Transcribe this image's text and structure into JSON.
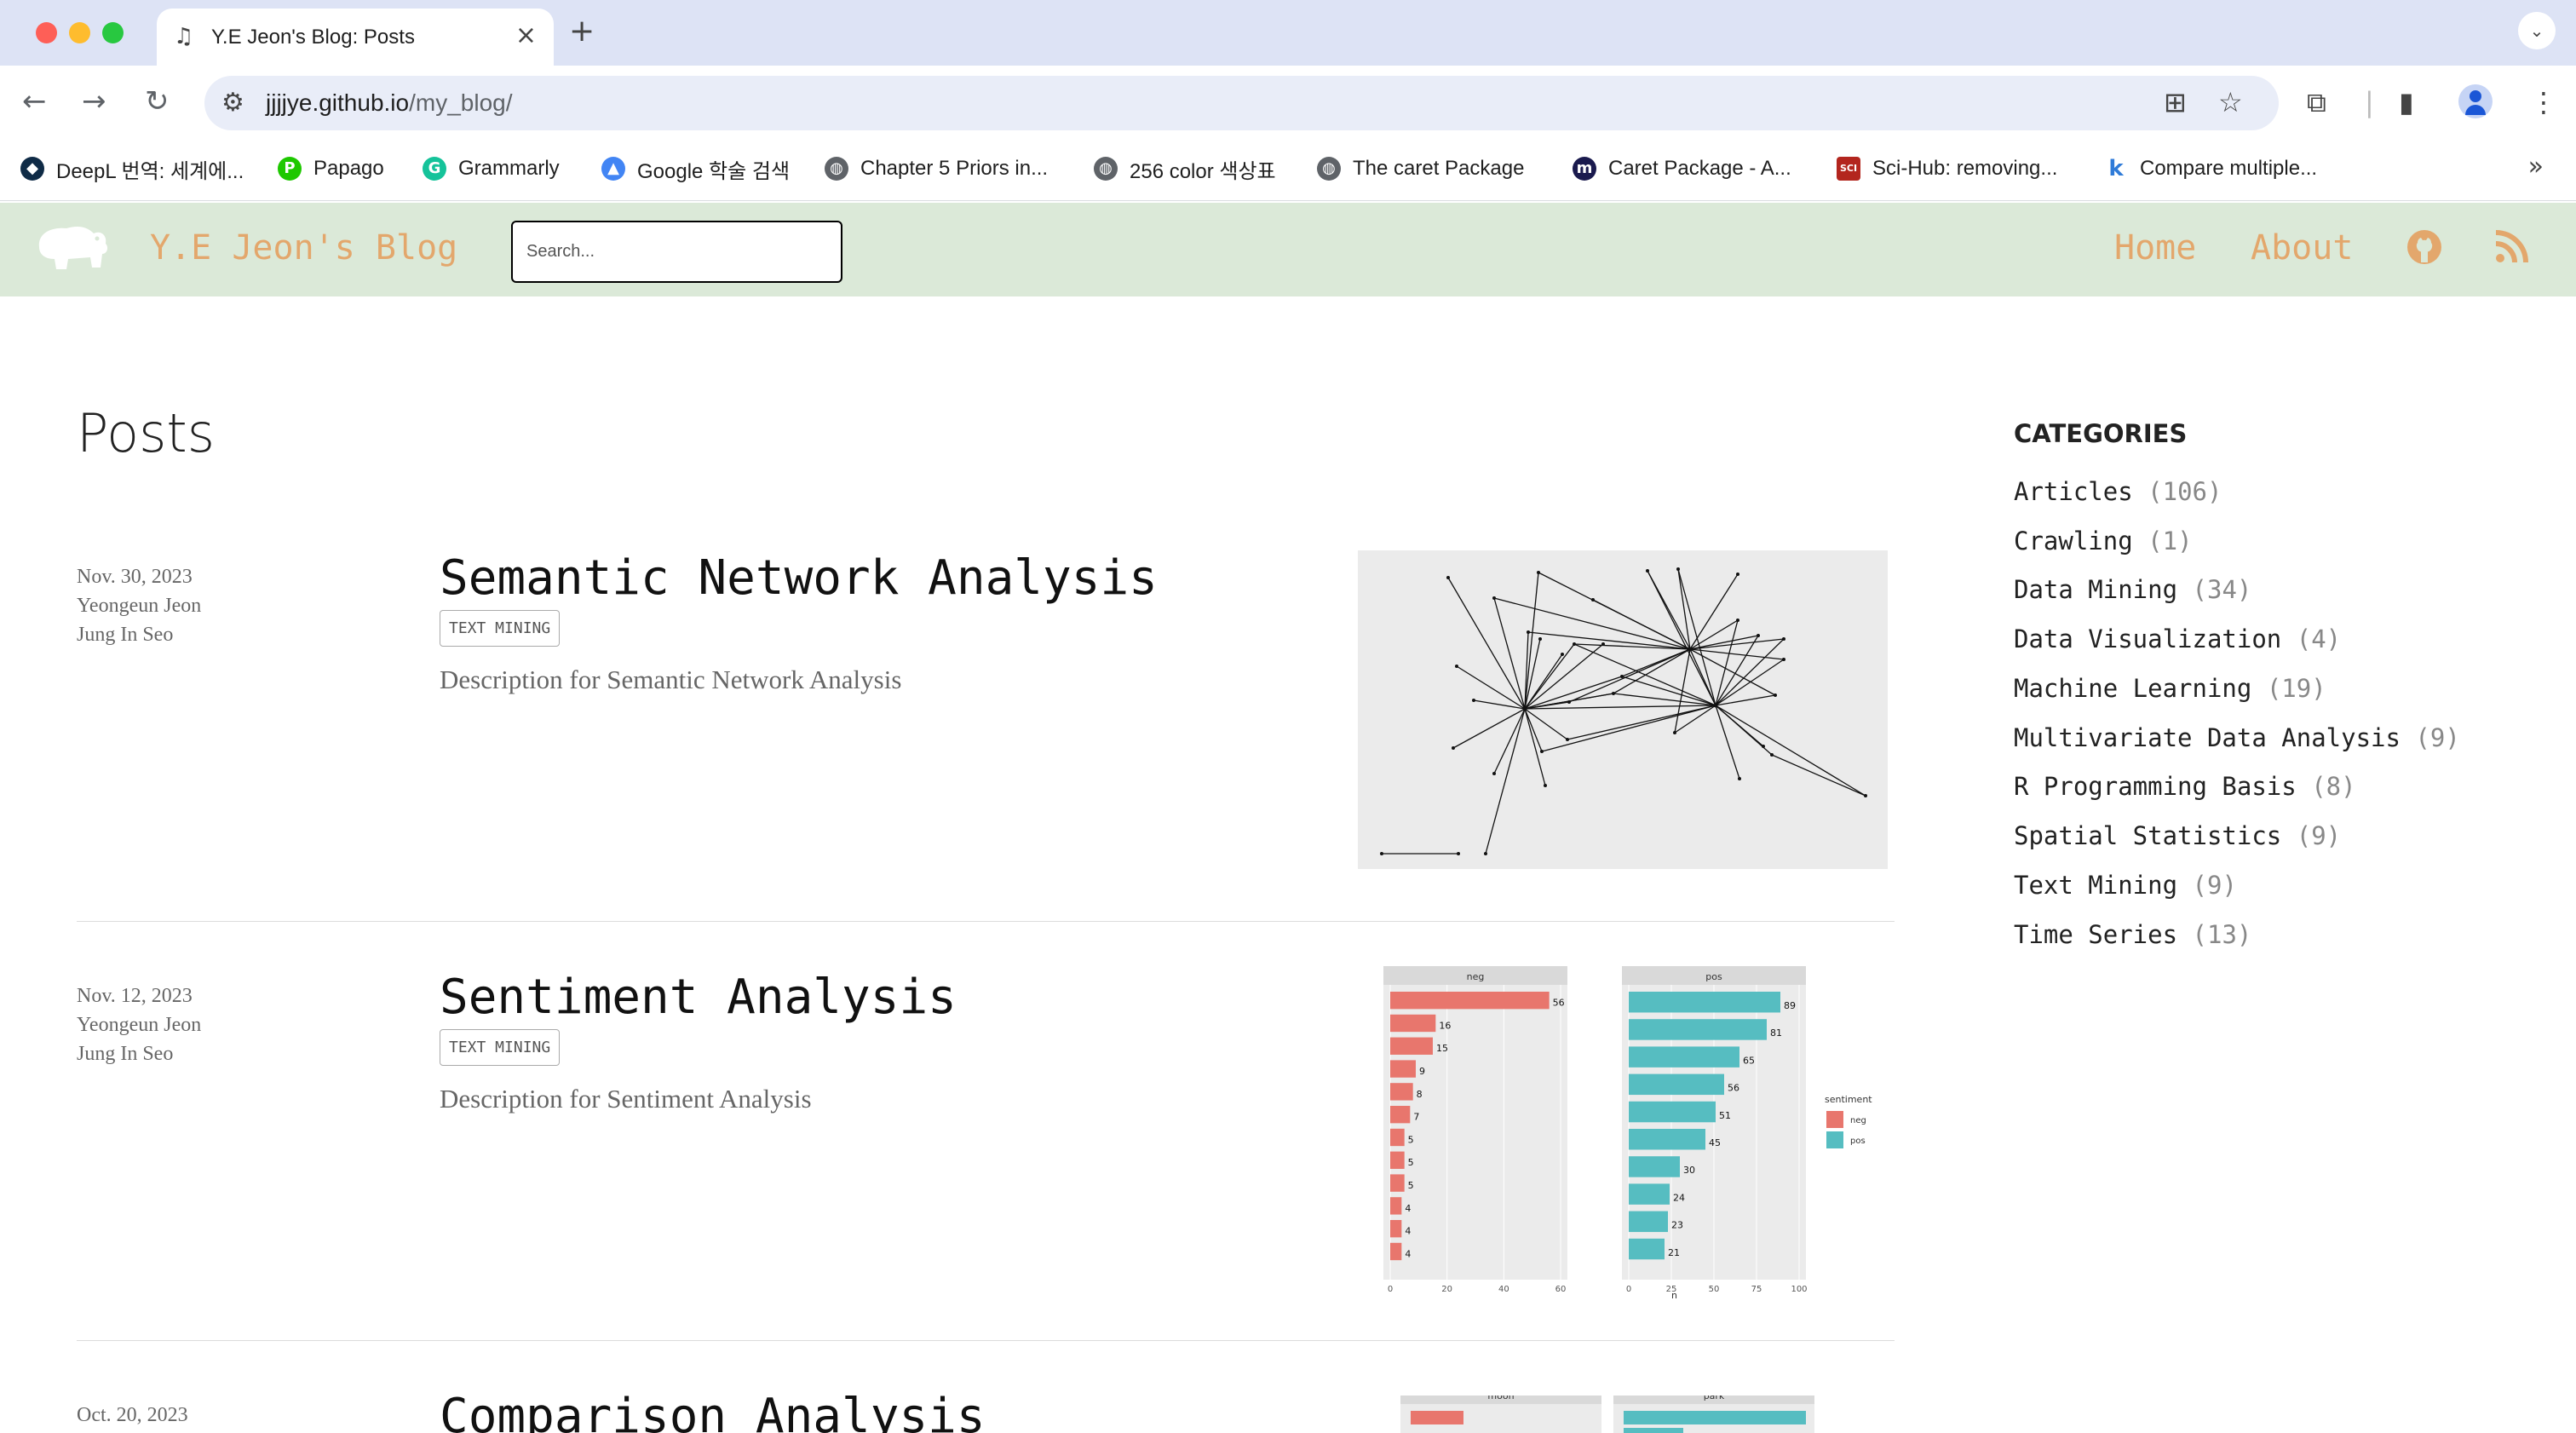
{
  "browser": {
    "tab_title": "Y.E Jeon's Blog: Posts",
    "url_host": "jjjjye.github.io",
    "url_path": "/my_blog/",
    "bookmarks": [
      {
        "label": "DeepL 번역: 세계에...",
        "icon": "deepl-icon",
        "color": "#0f2b46"
      },
      {
        "label": "Papago",
        "icon": "papago-icon",
        "color": "#1ec800"
      },
      {
        "label": "Grammarly",
        "icon": "grammarly-icon",
        "color": "#15c39a"
      },
      {
        "label": "Google 학술 검색",
        "icon": "scholar-icon",
        "color": "#4285f4"
      },
      {
        "label": "Chapter 5 Priors in...",
        "icon": "globe-icon",
        "color": "#5f6368"
      },
      {
        "label": "256 color 색상표",
        "icon": "globe-icon",
        "color": "#5f6368"
      },
      {
        "label": "The caret Package",
        "icon": "globe-icon",
        "color": "#5f6368"
      },
      {
        "label": "Caret Package - A...",
        "icon": "medium-icon",
        "color": "#1a1a4e"
      },
      {
        "label": "Sci-Hub: removing...",
        "icon": "scihub-icon",
        "color": "#b3261e"
      },
      {
        "label": "Compare multiple...",
        "icon": "k-icon",
        "color": "#2f7bd8"
      }
    ]
  },
  "site": {
    "title": "Y.E Jeon's Blog",
    "search_placeholder": "Search...",
    "nav": {
      "home": "Home",
      "about": "About"
    },
    "accent": "#e3a76c",
    "header_bg": "#dbe9d8"
  },
  "page": {
    "heading": "Posts"
  },
  "posts": [
    {
      "date": "Nov. 30, 2023",
      "authors": [
        "Yeongeun Jeon",
        "Jung In Seo"
      ],
      "title": "Semantic Network Analysis",
      "tag": "TEXT MINING",
      "description": "Description for Semantic Network Analysis"
    },
    {
      "date": "Nov. 12, 2023",
      "authors": [
        "Yeongeun Jeon",
        "Jung In Seo"
      ],
      "title": "Sentiment Analysis",
      "tag": "TEXT MINING",
      "description": "Description for Sentiment Analysis"
    },
    {
      "date": "Oct. 20, 2023",
      "authors": [],
      "title": "Comparison Analysis",
      "tag": "",
      "description": ""
    }
  ],
  "thumbs": {
    "sentiment": {
      "neg_label": "neg",
      "pos_label": "pos",
      "neg_values": [
        56,
        16,
        15,
        9,
        8,
        7,
        5,
        5,
        5,
        4,
        4,
        4
      ],
      "pos_values": [
        89,
        81,
        65,
        56,
        51,
        45,
        30,
        24,
        23,
        21
      ],
      "neg_ticks": [
        "0",
        "20",
        "40",
        "60"
      ],
      "pos_ticks": [
        "0",
        "25",
        "50",
        "75",
        "100"
      ],
      "xlabel": "n",
      "legend_title": "sentiment",
      "neg_color": "#e8766d",
      "pos_color": "#56bdc1"
    },
    "comparison": {
      "left_label": "moon",
      "right_label": "park"
    }
  },
  "categories": {
    "title": "CATEGORIES",
    "items": [
      {
        "name": "Articles",
        "count": "(106)"
      },
      {
        "name": "Crawling",
        "count": "(1)"
      },
      {
        "name": "Data Mining",
        "count": "(34)"
      },
      {
        "name": "Data Visualization",
        "count": "(4)"
      },
      {
        "name": "Machine Learning",
        "count": "(19)"
      },
      {
        "name": "Multivariate Data Analysis",
        "count": "(9)"
      },
      {
        "name": "R Programming Basis",
        "count": "(8)"
      },
      {
        "name": "Spatial Statistics",
        "count": "(9)"
      },
      {
        "name": "Text Mining",
        "count": "(9)"
      },
      {
        "name": "Time Series",
        "count": "(13)"
      }
    ]
  }
}
